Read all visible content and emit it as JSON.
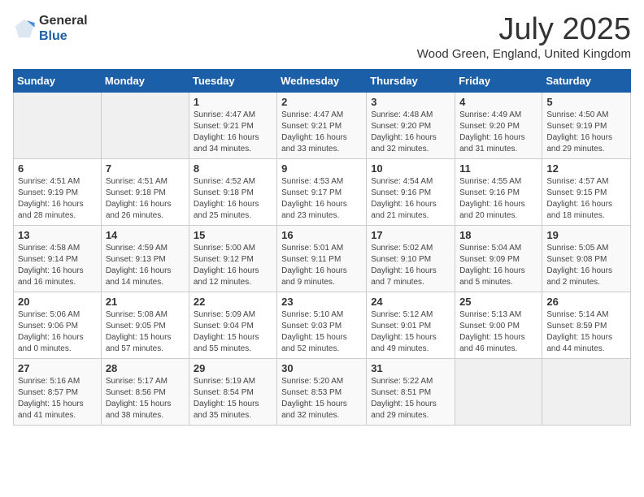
{
  "header": {
    "logo_line1": "General",
    "logo_line2": "Blue",
    "title": "July 2025",
    "subtitle": "Wood Green, England, United Kingdom"
  },
  "weekdays": [
    "Sunday",
    "Monday",
    "Tuesday",
    "Wednesday",
    "Thursday",
    "Friday",
    "Saturday"
  ],
  "weeks": [
    [
      {
        "day": "",
        "info": ""
      },
      {
        "day": "",
        "info": ""
      },
      {
        "day": "1",
        "info": "Sunrise: 4:47 AM\nSunset: 9:21 PM\nDaylight: 16 hours\nand 34 minutes."
      },
      {
        "day": "2",
        "info": "Sunrise: 4:47 AM\nSunset: 9:21 PM\nDaylight: 16 hours\nand 33 minutes."
      },
      {
        "day": "3",
        "info": "Sunrise: 4:48 AM\nSunset: 9:20 PM\nDaylight: 16 hours\nand 32 minutes."
      },
      {
        "day": "4",
        "info": "Sunrise: 4:49 AM\nSunset: 9:20 PM\nDaylight: 16 hours\nand 31 minutes."
      },
      {
        "day": "5",
        "info": "Sunrise: 4:50 AM\nSunset: 9:19 PM\nDaylight: 16 hours\nand 29 minutes."
      }
    ],
    [
      {
        "day": "6",
        "info": "Sunrise: 4:51 AM\nSunset: 9:19 PM\nDaylight: 16 hours\nand 28 minutes."
      },
      {
        "day": "7",
        "info": "Sunrise: 4:51 AM\nSunset: 9:18 PM\nDaylight: 16 hours\nand 26 minutes."
      },
      {
        "day": "8",
        "info": "Sunrise: 4:52 AM\nSunset: 9:18 PM\nDaylight: 16 hours\nand 25 minutes."
      },
      {
        "day": "9",
        "info": "Sunrise: 4:53 AM\nSunset: 9:17 PM\nDaylight: 16 hours\nand 23 minutes."
      },
      {
        "day": "10",
        "info": "Sunrise: 4:54 AM\nSunset: 9:16 PM\nDaylight: 16 hours\nand 21 minutes."
      },
      {
        "day": "11",
        "info": "Sunrise: 4:55 AM\nSunset: 9:16 PM\nDaylight: 16 hours\nand 20 minutes."
      },
      {
        "day": "12",
        "info": "Sunrise: 4:57 AM\nSunset: 9:15 PM\nDaylight: 16 hours\nand 18 minutes."
      }
    ],
    [
      {
        "day": "13",
        "info": "Sunrise: 4:58 AM\nSunset: 9:14 PM\nDaylight: 16 hours\nand 16 minutes."
      },
      {
        "day": "14",
        "info": "Sunrise: 4:59 AM\nSunset: 9:13 PM\nDaylight: 16 hours\nand 14 minutes."
      },
      {
        "day": "15",
        "info": "Sunrise: 5:00 AM\nSunset: 9:12 PM\nDaylight: 16 hours\nand 12 minutes."
      },
      {
        "day": "16",
        "info": "Sunrise: 5:01 AM\nSunset: 9:11 PM\nDaylight: 16 hours\nand 9 minutes."
      },
      {
        "day": "17",
        "info": "Sunrise: 5:02 AM\nSunset: 9:10 PM\nDaylight: 16 hours\nand 7 minutes."
      },
      {
        "day": "18",
        "info": "Sunrise: 5:04 AM\nSunset: 9:09 PM\nDaylight: 16 hours\nand 5 minutes."
      },
      {
        "day": "19",
        "info": "Sunrise: 5:05 AM\nSunset: 9:08 PM\nDaylight: 16 hours\nand 2 minutes."
      }
    ],
    [
      {
        "day": "20",
        "info": "Sunrise: 5:06 AM\nSunset: 9:06 PM\nDaylight: 16 hours\nand 0 minutes."
      },
      {
        "day": "21",
        "info": "Sunrise: 5:08 AM\nSunset: 9:05 PM\nDaylight: 15 hours\nand 57 minutes."
      },
      {
        "day": "22",
        "info": "Sunrise: 5:09 AM\nSunset: 9:04 PM\nDaylight: 15 hours\nand 55 minutes."
      },
      {
        "day": "23",
        "info": "Sunrise: 5:10 AM\nSunset: 9:03 PM\nDaylight: 15 hours\nand 52 minutes."
      },
      {
        "day": "24",
        "info": "Sunrise: 5:12 AM\nSunset: 9:01 PM\nDaylight: 15 hours\nand 49 minutes."
      },
      {
        "day": "25",
        "info": "Sunrise: 5:13 AM\nSunset: 9:00 PM\nDaylight: 15 hours\nand 46 minutes."
      },
      {
        "day": "26",
        "info": "Sunrise: 5:14 AM\nSunset: 8:59 PM\nDaylight: 15 hours\nand 44 minutes."
      }
    ],
    [
      {
        "day": "27",
        "info": "Sunrise: 5:16 AM\nSunset: 8:57 PM\nDaylight: 15 hours\nand 41 minutes."
      },
      {
        "day": "28",
        "info": "Sunrise: 5:17 AM\nSunset: 8:56 PM\nDaylight: 15 hours\nand 38 minutes."
      },
      {
        "day": "29",
        "info": "Sunrise: 5:19 AM\nSunset: 8:54 PM\nDaylight: 15 hours\nand 35 minutes."
      },
      {
        "day": "30",
        "info": "Sunrise: 5:20 AM\nSunset: 8:53 PM\nDaylight: 15 hours\nand 32 minutes."
      },
      {
        "day": "31",
        "info": "Sunrise: 5:22 AM\nSunset: 8:51 PM\nDaylight: 15 hours\nand 29 minutes."
      },
      {
        "day": "",
        "info": ""
      },
      {
        "day": "",
        "info": ""
      }
    ]
  ]
}
